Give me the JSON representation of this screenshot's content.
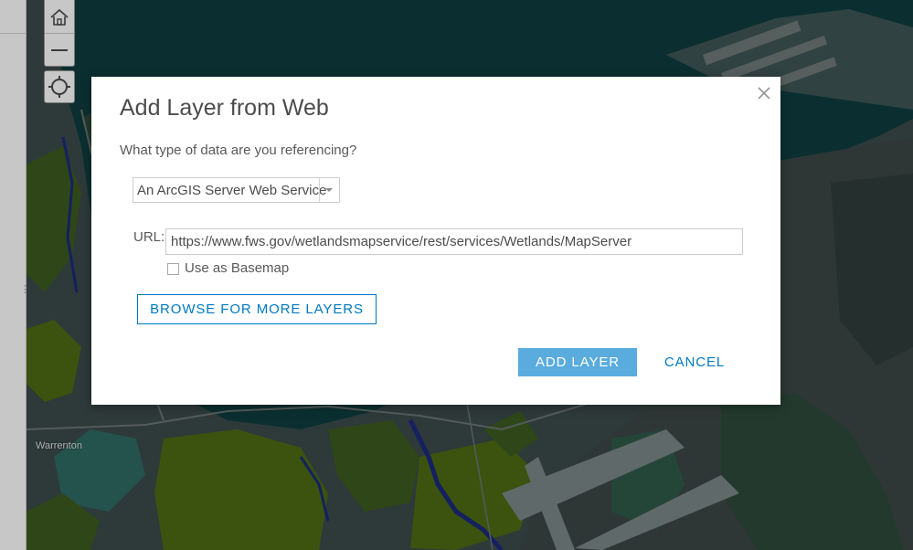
{
  "map": {
    "place_label": "Warrenton",
    "colors": {
      "water": "#0f3d3e",
      "land": "#3c4a4a",
      "wetland_green": "#3d5b1f",
      "wetland_bright": "#4c6b14",
      "channel": "#1b2a7a",
      "road": "#6b7575",
      "pale": "#7c8787"
    }
  },
  "map_controls": {
    "home_icon": "home-icon",
    "zoom_out_icon": "minus-icon",
    "locate_icon": "crosshair-icon"
  },
  "dialog": {
    "title": "Add Layer from Web",
    "question": "What type of data are you referencing?",
    "data_type": {
      "selected": "An ArcGIS Server Web Service"
    },
    "url_label": "URL:",
    "url_value": "https://www.fws.gov/wetlandsmapservice/rest/services/Wetlands/MapServer",
    "basemap_checkbox": {
      "label": "Use as Basemap",
      "checked": false
    },
    "browse_label": "BROWSE FOR MORE LAYERS",
    "add_label": "ADD LAYER",
    "cancel_label": "CANCEL",
    "colors": {
      "accent": "#0079c1",
      "primary_button": "#5aacdf"
    }
  }
}
